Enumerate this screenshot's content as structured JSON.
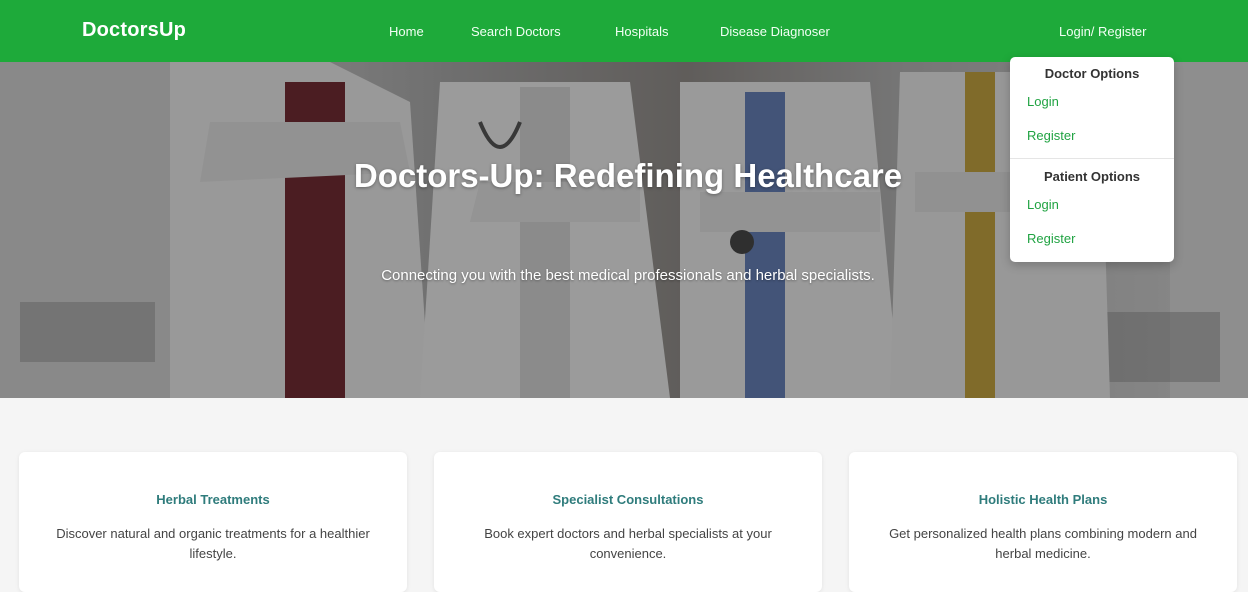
{
  "colors": {
    "brand_green": "#1eaa3a",
    "link_green": "#20a342",
    "card_title": "#2f7c7c"
  },
  "navbar": {
    "brand": "DoctorsUp",
    "links": [
      "Home",
      "Search Doctors",
      "Hospitals",
      "Disease Diagnoser"
    ],
    "auth": "Login/ Register"
  },
  "hero": {
    "title": "Doctors-Up: Redefining Healthcare",
    "subtitle": "Connecting you with the best medical professionals and herbal specialists."
  },
  "dropdown": {
    "doctor_heading": "Doctor Options",
    "doctor_login": "Login",
    "doctor_register": "Register",
    "patient_heading": "Patient Options",
    "patient_login": "Login",
    "patient_register": "Register"
  },
  "cards": [
    {
      "title": "Herbal Treatments",
      "text": "Discover natural and organic treatments for a healthier lifestyle."
    },
    {
      "title": "Specialist Consultations",
      "text": "Book expert doctors and herbal specialists at your convenience."
    },
    {
      "title": "Holistic Health Plans",
      "text": "Get personalized health plans combining modern and herbal medicine."
    }
  ]
}
